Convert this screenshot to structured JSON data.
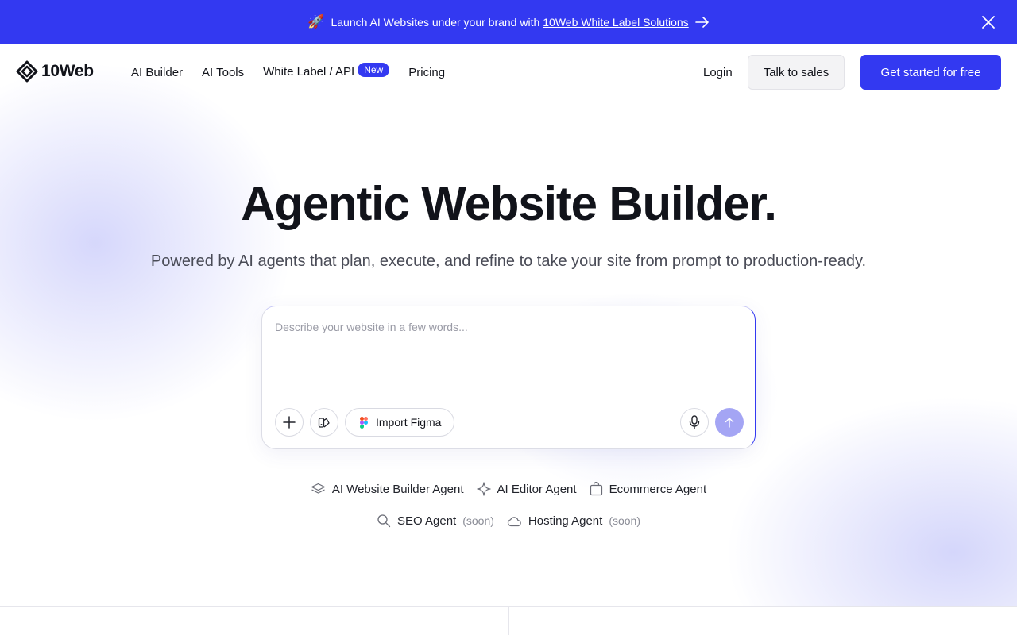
{
  "banner": {
    "emoji": "🚀",
    "text": "Launch AI Websites under your brand with",
    "link_text": "10Web White Label Solutions",
    "icons": [
      "rocket-icon",
      "arrow-right-icon",
      "close-icon"
    ]
  },
  "nav": {
    "logo_text": "10Web",
    "items": [
      {
        "label": "AI Builder"
      },
      {
        "label": "AI Tools"
      },
      {
        "label": "White Label / API",
        "badge": "New"
      },
      {
        "label": "Pricing"
      }
    ],
    "login": "Login",
    "talk_to_sales": "Talk to sales",
    "get_started": "Get started for free"
  },
  "hero": {
    "title": "Agentic Website Builder.",
    "subtitle": "Powered by AI agents that plan, execute, and refine to take your site from prompt to production-ready."
  },
  "prompt": {
    "placeholder": "Describe your website in a few words...",
    "value": "",
    "import_figma": "Import Figma",
    "icons": [
      "plus-icon",
      "style-icon",
      "figma-icon",
      "microphone-icon",
      "arrow-up-icon"
    ]
  },
  "agents": {
    "row1": [
      {
        "label": "AI Website Builder Agent",
        "icon": "layers-icon"
      },
      {
        "label": "AI Editor Agent",
        "icon": "sparkle-icon"
      },
      {
        "label": "Ecommerce Agent",
        "icon": "shopping-bag-icon"
      }
    ],
    "row2": [
      {
        "label": "SEO Agent",
        "soon": "(soon)",
        "icon": "search-icon"
      },
      {
        "label": "Hosting Agent",
        "soon": "(soon)",
        "icon": "cloud-icon"
      }
    ]
  },
  "colors": {
    "brand": "#3339f1",
    "send_button_disabled": "#a4a5f4",
    "text": "#11131a",
    "muted": "#4a4c57"
  }
}
